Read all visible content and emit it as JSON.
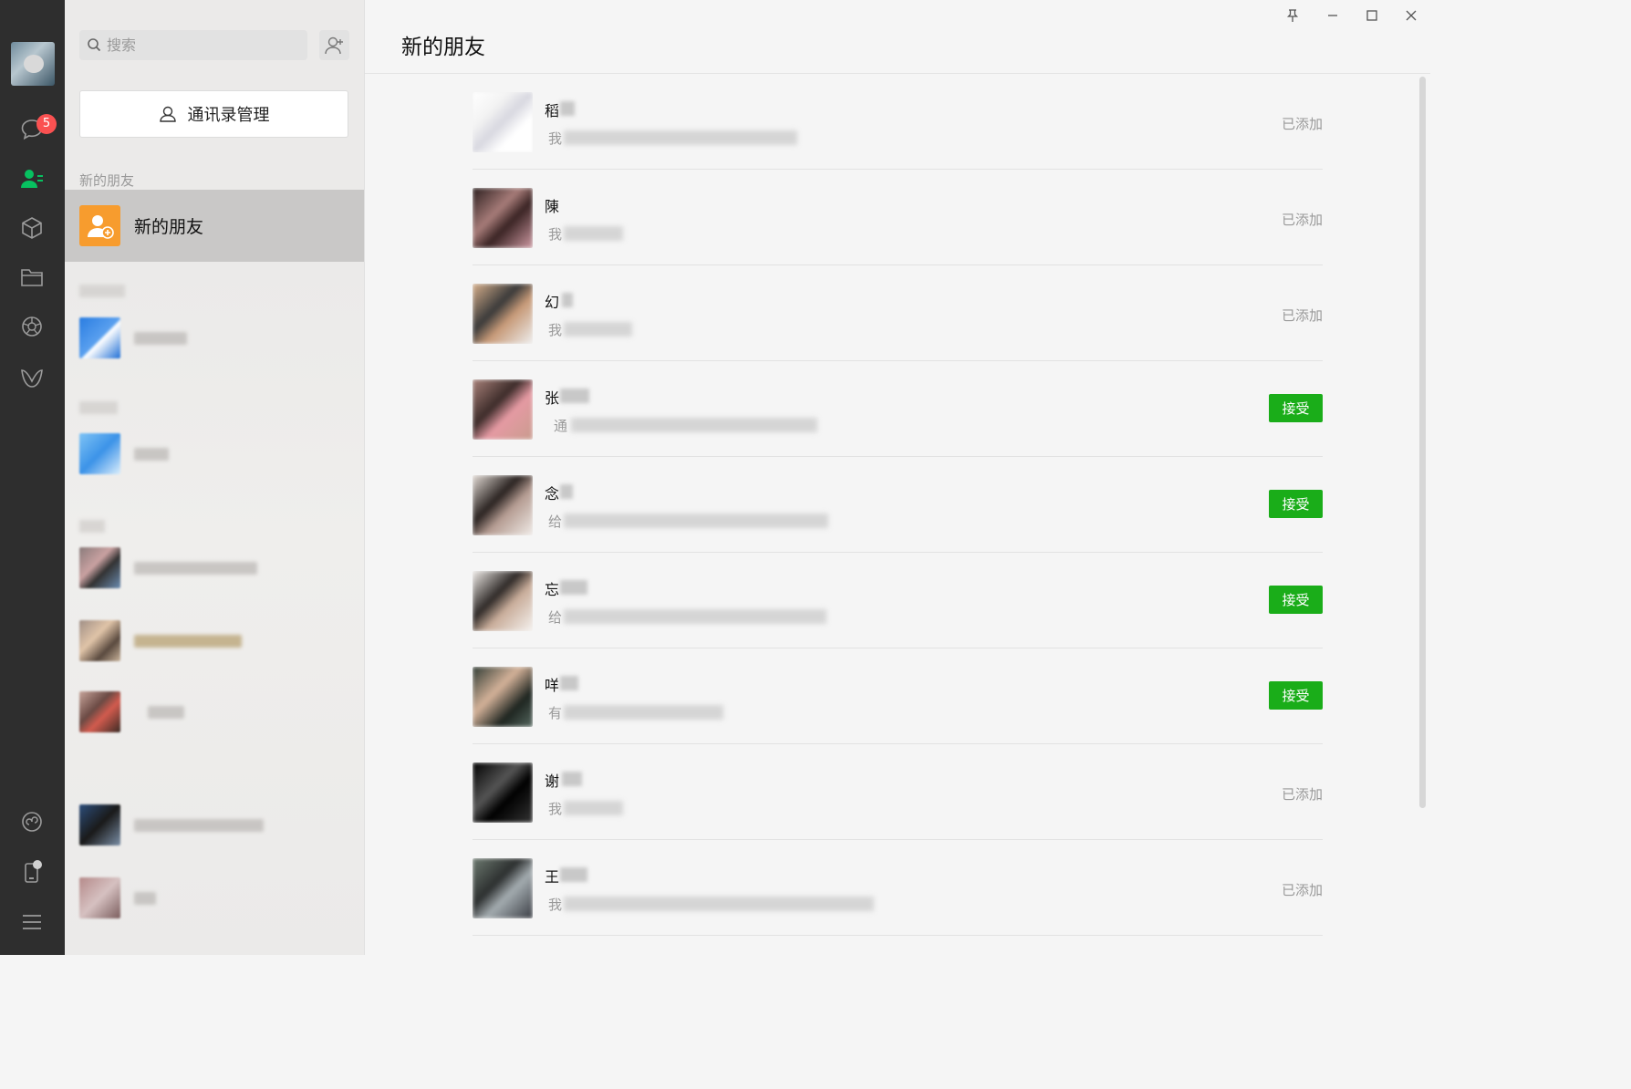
{
  "nav": {
    "chat_badge": "5",
    "icons": [
      "chat-icon",
      "contacts-icon",
      "favorites-icon",
      "files-icon",
      "moments-icon",
      "channels-icon",
      "mini-program-icon",
      "phone-icon",
      "menu-icon"
    ]
  },
  "contacts_panel": {
    "search_placeholder": "搜索",
    "manage_label": "通讯录管理",
    "section_label": "新的朋友",
    "new_friends_label": "新的朋友"
  },
  "main": {
    "title": "新的朋友",
    "requests": [
      {
        "name": "稻",
        "msg": "我",
        "action": "added",
        "status": "已添加"
      },
      {
        "name": "陳",
        "msg": "我",
        "action": "added",
        "status": "已添加"
      },
      {
        "name": "幻",
        "msg": "我",
        "action": "added",
        "status": "已添加"
      },
      {
        "name": "张",
        "msg": "通",
        "action": "accept",
        "status": "接受"
      },
      {
        "name": "念",
        "msg": "给",
        "action": "accept",
        "status": "接受"
      },
      {
        "name": "忘",
        "msg": "给",
        "action": "accept",
        "status": "接受"
      },
      {
        "name": "咩",
        "msg": "有",
        "action": "accept",
        "status": "接受"
      },
      {
        "name": "谢",
        "msg": "我",
        "action": "added",
        "status": "已添加"
      },
      {
        "name": "王",
        "msg": "我",
        "action": "added",
        "status": "已添加"
      }
    ]
  },
  "colors": {
    "nav_bg": "#2e2e2e",
    "accent_green": "#1aad19",
    "new_friend_orange": "#f79c2e",
    "badge_red": "#fa5151"
  }
}
